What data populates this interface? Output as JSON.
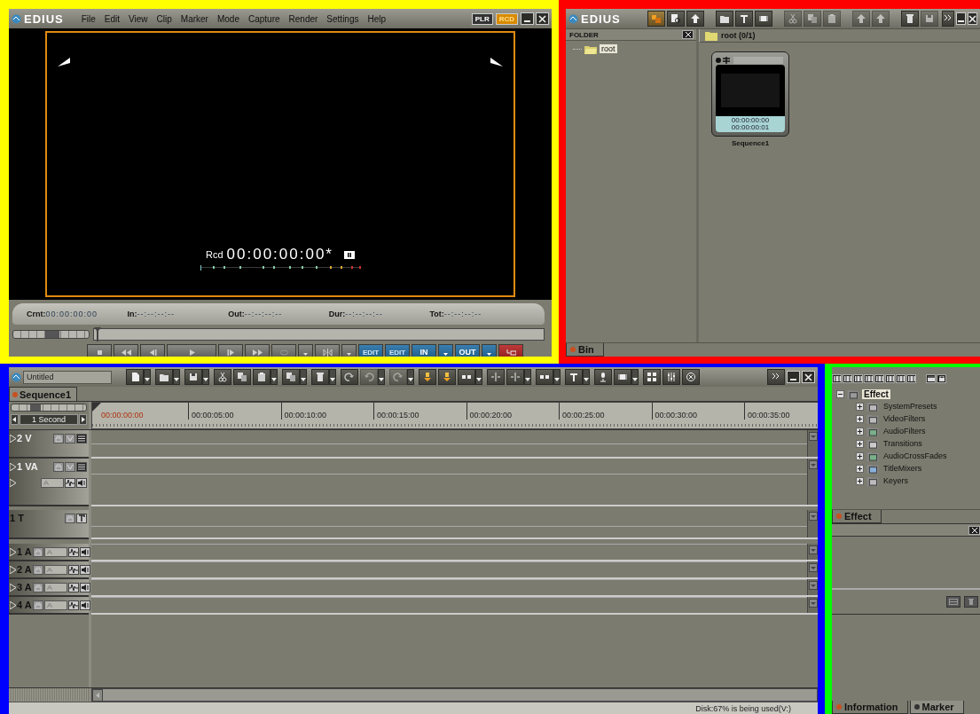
{
  "player": {
    "logo": "EDIUS",
    "menu": [
      "File",
      "Edit",
      "View",
      "Clip",
      "Marker",
      "Mode",
      "Capture",
      "Render",
      "Settings",
      "Help"
    ],
    "mode_buttons": [
      {
        "label": "PLR",
        "selected": false
      },
      {
        "label": "RCD",
        "selected": true
      }
    ],
    "overlay": {
      "mode": "Rcd",
      "timecode": "00:00:00:00*"
    },
    "timecodes": [
      {
        "label": "Crnt:",
        "value": "00:00:00:00"
      },
      {
        "label": "In:",
        "value": "--:--:--:--"
      },
      {
        "label": "Out:",
        "value": "--:--:--:--"
      },
      {
        "label": "Dur:",
        "value": "--:--:--:--"
      },
      {
        "label": "Tot:",
        "value": "--:--:--:--"
      }
    ],
    "shuttle": {
      "level": 0.5
    },
    "edit_buttons": [
      "EDIT",
      "EDIT"
    ],
    "point_buttons": [
      "IN",
      "OUT"
    ]
  },
  "bin": {
    "logo": "EDIUS",
    "folder_header": "FOLDER",
    "folders": [
      {
        "label": "root",
        "selected": true
      }
    ],
    "path": "root (0/1)",
    "clips": [
      {
        "name": "Sequence1",
        "time_in": "00:00:00:00",
        "time_out": "00:00:00:01"
      }
    ],
    "tabs": [
      {
        "label": "Bin",
        "selected": true
      }
    ]
  },
  "timeline": {
    "project": "Untitled",
    "sequence_tabs": [
      {
        "label": "Sequence1",
        "selected": true
      }
    ],
    "scale": "1 Second",
    "zoom": {
      "level": 0.3
    },
    "ruler": [
      "00:00:00:00",
      "00:00:05:00",
      "00:00:10:00",
      "00:00:15:00",
      "00:00:20:00",
      "00:00:25:00",
      "00:00:30:00",
      "00:00:35:00"
    ],
    "tracks": [
      {
        "label": "2 V",
        "kind": "video"
      },
      {
        "label": "1 VA",
        "kind": "videoaudio"
      },
      {
        "label": "1 T",
        "kind": "title"
      },
      {
        "label": "1 A",
        "kind": "audio"
      },
      {
        "label": "2 A",
        "kind": "audio"
      },
      {
        "label": "3 A",
        "kind": "audio"
      },
      {
        "label": "4 A",
        "kind": "audio"
      }
    ],
    "status": "Disk:67% is being used(V:)"
  },
  "effects": {
    "tree": [
      {
        "label": "Effect",
        "expanded": true,
        "selected": true,
        "children": [
          {
            "label": "SystemPresets",
            "expanded": false,
            "selected": false
          },
          {
            "label": "VideoFilters",
            "expanded": false,
            "selected": false
          },
          {
            "label": "AudioFilters",
            "expanded": false,
            "selected": false
          },
          {
            "label": "Transitions",
            "expanded": false,
            "selected": false
          },
          {
            "label": "AudioCrossFades",
            "expanded": false,
            "selected": false
          },
          {
            "label": "TitleMixers",
            "expanded": false,
            "selected": false
          },
          {
            "label": "Keyers",
            "expanded": false,
            "selected": false
          }
        ]
      }
    ],
    "tabs": [
      {
        "label": "Effect",
        "selected": true
      }
    ],
    "bottom_tabs": [
      {
        "label": "Information",
        "selected": true
      },
      {
        "label": "Marker",
        "selected": false
      }
    ]
  }
}
